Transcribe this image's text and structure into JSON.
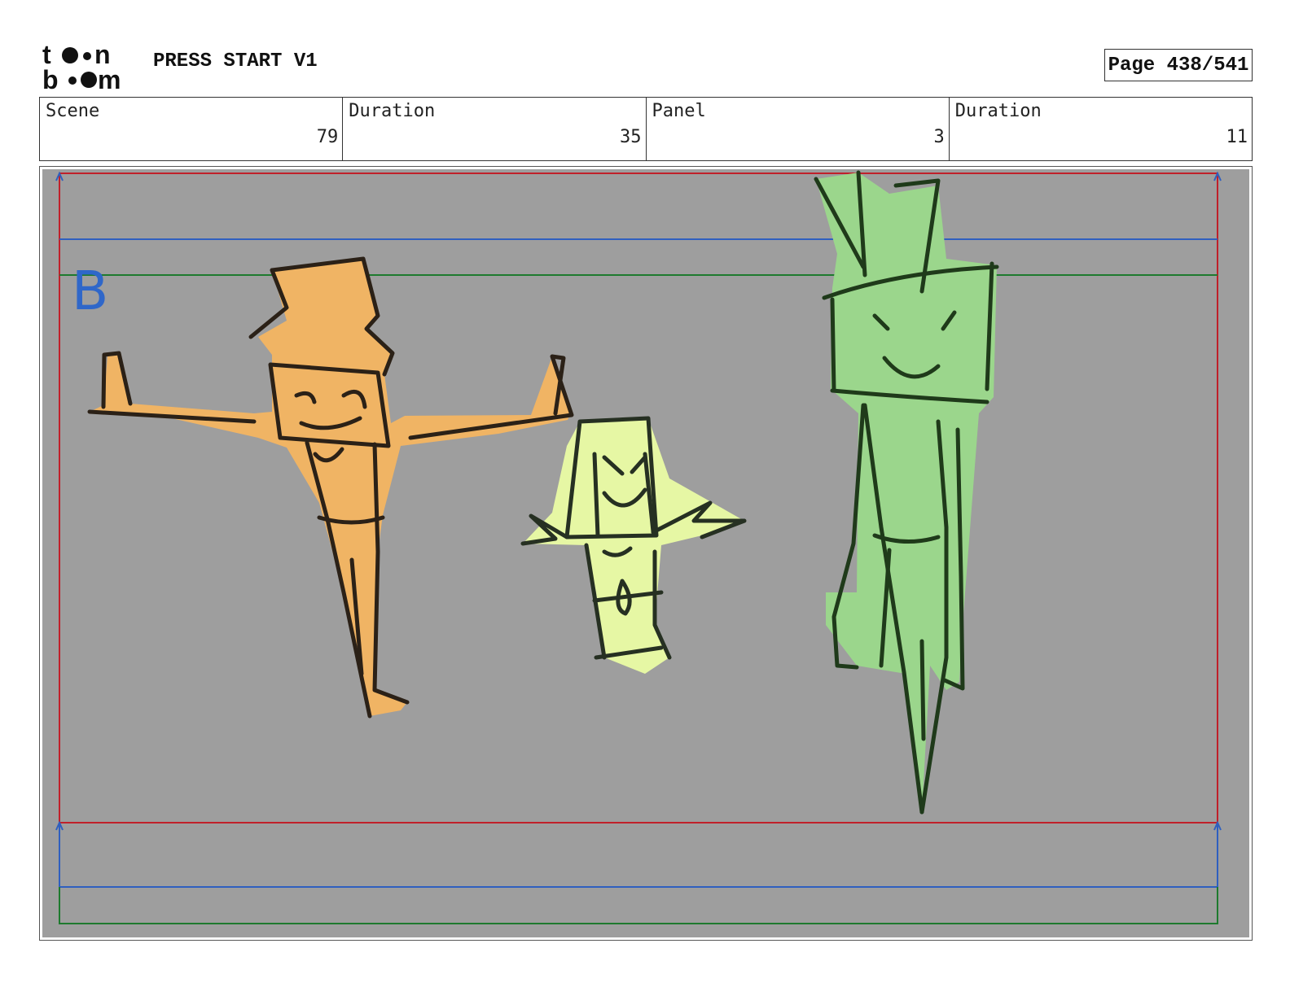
{
  "header": {
    "logo_text": "toon boom",
    "project_title": "PRESS START V1",
    "page_label": "Page 438/541"
  },
  "info_table": [
    {
      "label": "Scene",
      "value": "79"
    },
    {
      "label": "Duration",
      "value": "35"
    },
    {
      "label": "Panel",
      "value": "3"
    },
    {
      "label": "Duration",
      "value": "11"
    }
  ],
  "panel": {
    "layer_marker": "B",
    "background_color": "#9e9e9e",
    "guide_colors": {
      "safe": "#c0202a",
      "title": "#2f5fbf",
      "action": "#1e7a2e"
    },
    "characters": [
      {
        "name": "orange",
        "fill": "#f0b464"
      },
      {
        "name": "yellow",
        "fill": "#e6f7a4"
      },
      {
        "name": "green",
        "fill": "#9bd68c"
      }
    ]
  }
}
